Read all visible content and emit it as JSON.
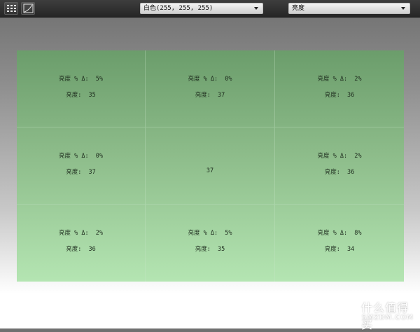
{
  "toolbar": {
    "grid_button_icon": "grid-view-icon",
    "curve_button_icon": "curve-chart-icon",
    "color_select": {
      "value": "白色(255, 255, 255)"
    },
    "metric_select": {
      "value": "亮度"
    }
  },
  "cells": [
    {
      "delta": "亮度 % Δ:  5%",
      "luminance": "亮度:  35"
    },
    {
      "delta": "亮度 % Δ:  0%",
      "luminance": "亮度:  37"
    },
    {
      "delta": "亮度 % Δ:  2%",
      "luminance": "亮度:  36"
    },
    {
      "delta": "亮度 % Δ:  0%",
      "luminance": "亮度:  37"
    },
    {
      "delta": "",
      "luminance": "37"
    },
    {
      "delta": "亮度 % Δ:  2%",
      "luminance": "亮度:  36"
    },
    {
      "delta": "亮度 % Δ:  2%",
      "luminance": "亮度:  36"
    },
    {
      "delta": "亮度 % Δ:  5%",
      "luminance": "亮度:  35"
    },
    {
      "delta": "亮度 % Δ:  8%",
      "luminance": "亮度:  34"
    }
  ],
  "watermark": {
    "cn": "什么值得买",
    "en": "SMZDM.COM",
    "logo_icon": "smzdm-logo-icon"
  },
  "colors": {
    "panel_top": "#6b9d6b",
    "panel_bottom": "#b4e5b2"
  }
}
